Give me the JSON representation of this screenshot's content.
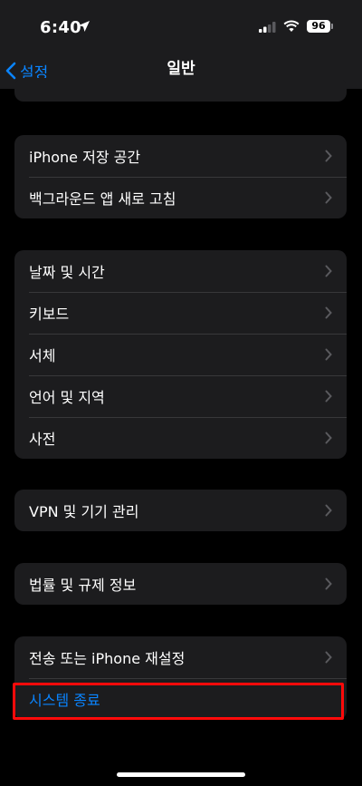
{
  "status_bar": {
    "time": "6:40",
    "battery": "96"
  },
  "nav": {
    "back_label": "설정",
    "title": "일반"
  },
  "groups": [
    {
      "items": [
        {
          "label": "iPhone 저장 공간"
        },
        {
          "label": "백그라운드 앱 새로 고침"
        }
      ]
    },
    {
      "items": [
        {
          "label": "날짜 및 시간"
        },
        {
          "label": "키보드"
        },
        {
          "label": "서체"
        },
        {
          "label": "언어 및 지역"
        },
        {
          "label": "사전"
        }
      ]
    },
    {
      "items": [
        {
          "label": "VPN 및 기기 관리"
        }
      ]
    },
    {
      "items": [
        {
          "label": "법률 및 규제 정보"
        }
      ]
    },
    {
      "items": [
        {
          "label": "전송 또는 iPhone 재설정"
        },
        {
          "label": "시스템 종료"
        }
      ]
    }
  ],
  "colors": {
    "accent": "#0a84ff",
    "highlight": "#ff0a0a",
    "group_bg": "#1c1c1e"
  }
}
